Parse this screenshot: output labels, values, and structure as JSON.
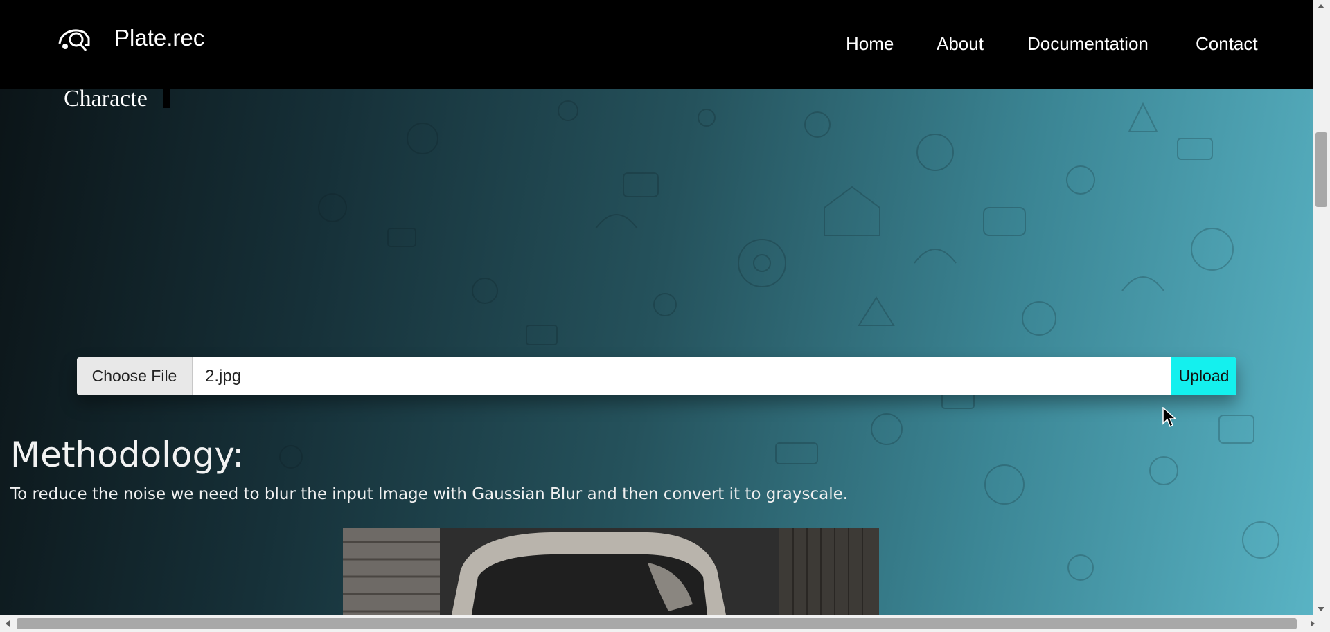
{
  "navbar": {
    "brand": "Plate.rec",
    "logo_icon": "car-search-icon",
    "links": [
      "Home",
      "About",
      "Documentation",
      "Contact"
    ]
  },
  "hero": {
    "partial_text": "Characte"
  },
  "upload": {
    "choose_label": "Choose File",
    "file_name": "2.jpg",
    "upload_label": "Upload",
    "accent_color": "#14f0ee"
  },
  "methodology": {
    "heading": "Methodology:",
    "text": "To reduce the noise we need to blur the input Image with Gaussian Blur and then convert it to grayscale."
  },
  "image": {
    "alt": "car-photo"
  }
}
